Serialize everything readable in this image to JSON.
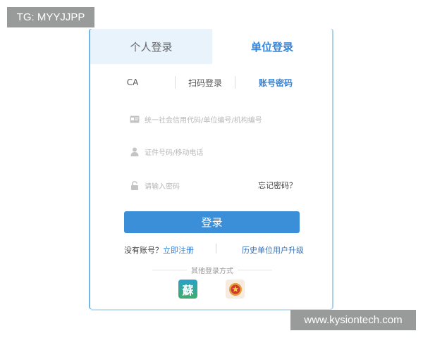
{
  "watermarks": {
    "top_left": "TG: MYYJJPP",
    "bottom_right": "www.kysiontech.com"
  },
  "tabs": [
    {
      "label": "个人登录",
      "active": false
    },
    {
      "label": "单位登录",
      "active": true
    }
  ],
  "subtabs": [
    {
      "label": "CA",
      "active": false
    },
    {
      "label": "扫码登录",
      "active": false
    },
    {
      "label": "账号密码",
      "active": true
    }
  ],
  "form": {
    "org_code_placeholder": "统一社会信用代码/单位编号/机构编号",
    "id_phone_placeholder": "证件号码/移动电话",
    "password_placeholder": "请输入密码",
    "forgot_password": "忘记密码？",
    "login_button": "登录"
  },
  "links": {
    "no_account": "没有账号？",
    "register": "立即注册",
    "history_upgrade": "历史单位用户升级"
  },
  "other_login": {
    "title": "其他登录方式",
    "app_icon_char": "蘇",
    "icons": [
      "su-app-icon",
      "national-emblem-icon"
    ]
  },
  "colors": {
    "accent": "#3a84d5",
    "button": "#3a8fd8",
    "tab_inactive_bg": "#e8f3fc"
  }
}
